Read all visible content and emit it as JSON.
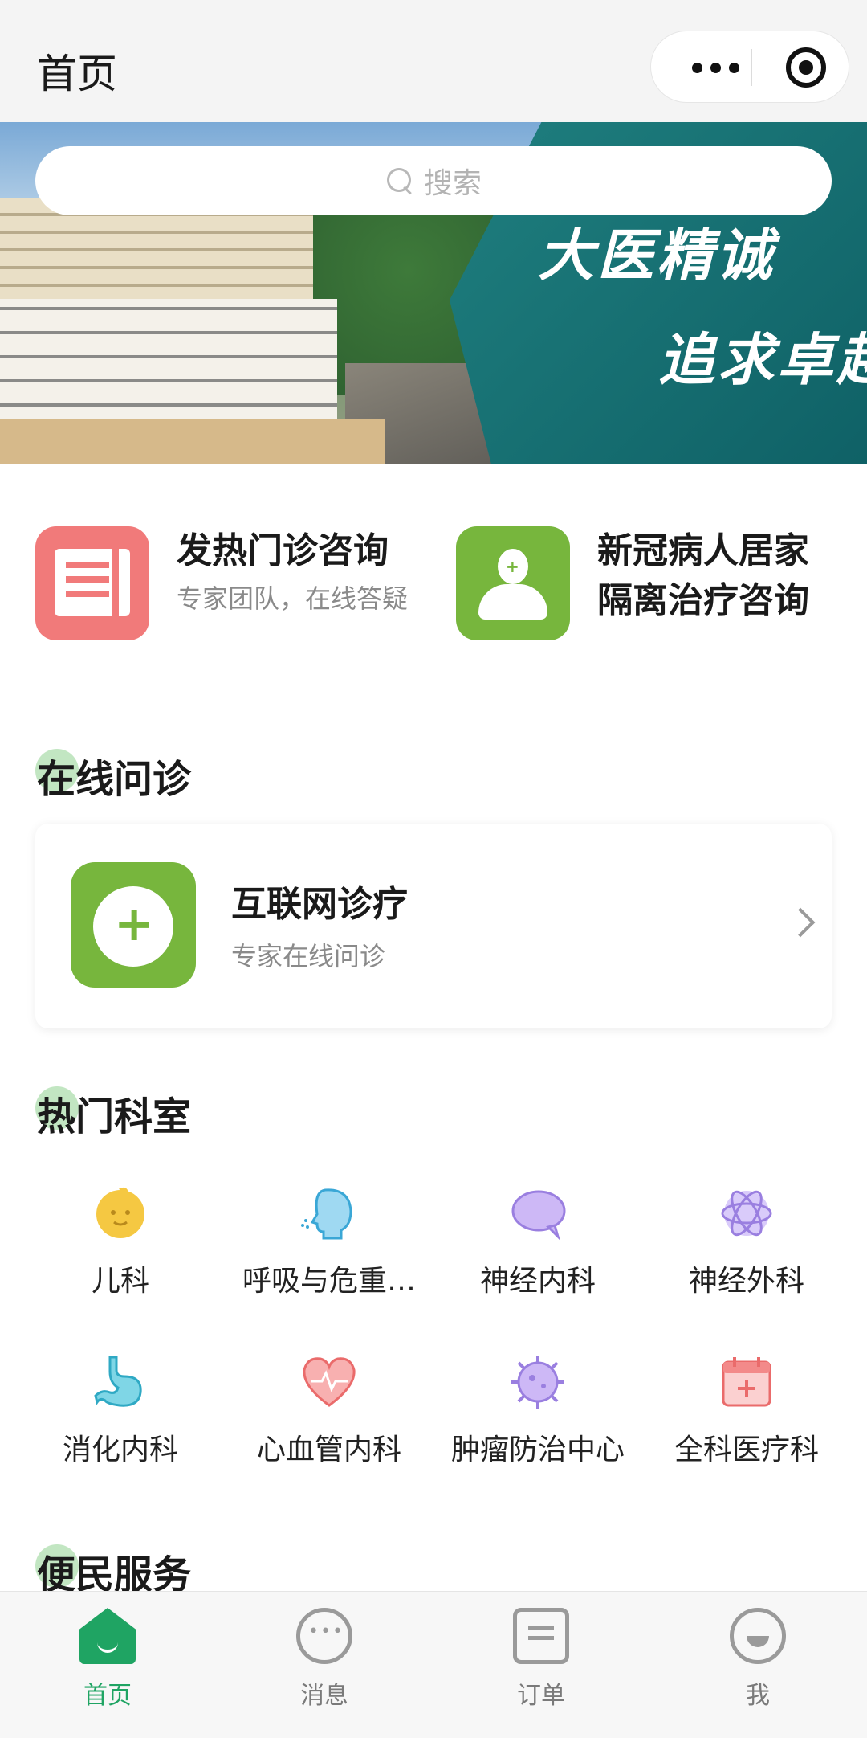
{
  "header": {
    "title": "首页"
  },
  "search": {
    "placeholder": "搜索"
  },
  "banner": {
    "slogan_line1": "大医精诚",
    "slogan_line2": "追求卓越"
  },
  "quick_services": [
    {
      "title": "发热门诊咨询",
      "subtitle": "专家团队，在线答疑",
      "icon": "document-icon",
      "color": "#f17a7a"
    },
    {
      "title_line1": "新冠病人居家",
      "title_line2": "隔离治疗咨询",
      "icon": "doctor-icon",
      "color": "#77b63d"
    }
  ],
  "online_section": {
    "title": "在线问诊",
    "card": {
      "title": "互联网诊疗",
      "subtitle": "专家在线问诊",
      "icon": "medical-chat-icon"
    }
  },
  "departments_section": {
    "title": "热门科室",
    "items": [
      {
        "label": "儿科",
        "icon": "child-icon",
        "color": "#f5c842"
      },
      {
        "label": "呼吸与危重…",
        "icon": "respiratory-icon",
        "color": "#5bbde8"
      },
      {
        "label": "神经内科",
        "icon": "speech-bubble-icon",
        "color": "#b79cf0"
      },
      {
        "label": "神经外科",
        "icon": "atom-icon",
        "color": "#b79cf0"
      },
      {
        "label": "消化内科",
        "icon": "stomach-icon",
        "color": "#5bc3d8"
      },
      {
        "label": "心血管内科",
        "icon": "heart-icon",
        "color": "#f38a8a"
      },
      {
        "label": "肿瘤防治中心",
        "icon": "virus-icon",
        "color": "#b79cf0"
      },
      {
        "label": "全科医疗科",
        "icon": "calendar-plus-icon",
        "color": "#f38a8a"
      }
    ]
  },
  "services_section": {
    "title": "便民服务"
  },
  "tabbar": {
    "items": [
      {
        "label": "首页",
        "icon": "home-icon",
        "active": true
      },
      {
        "label": "消息",
        "icon": "message-icon",
        "active": false
      },
      {
        "label": "订单",
        "icon": "order-icon",
        "active": false
      },
      {
        "label": "我",
        "icon": "profile-icon",
        "active": false
      }
    ],
    "active_color": "#1fa463"
  }
}
